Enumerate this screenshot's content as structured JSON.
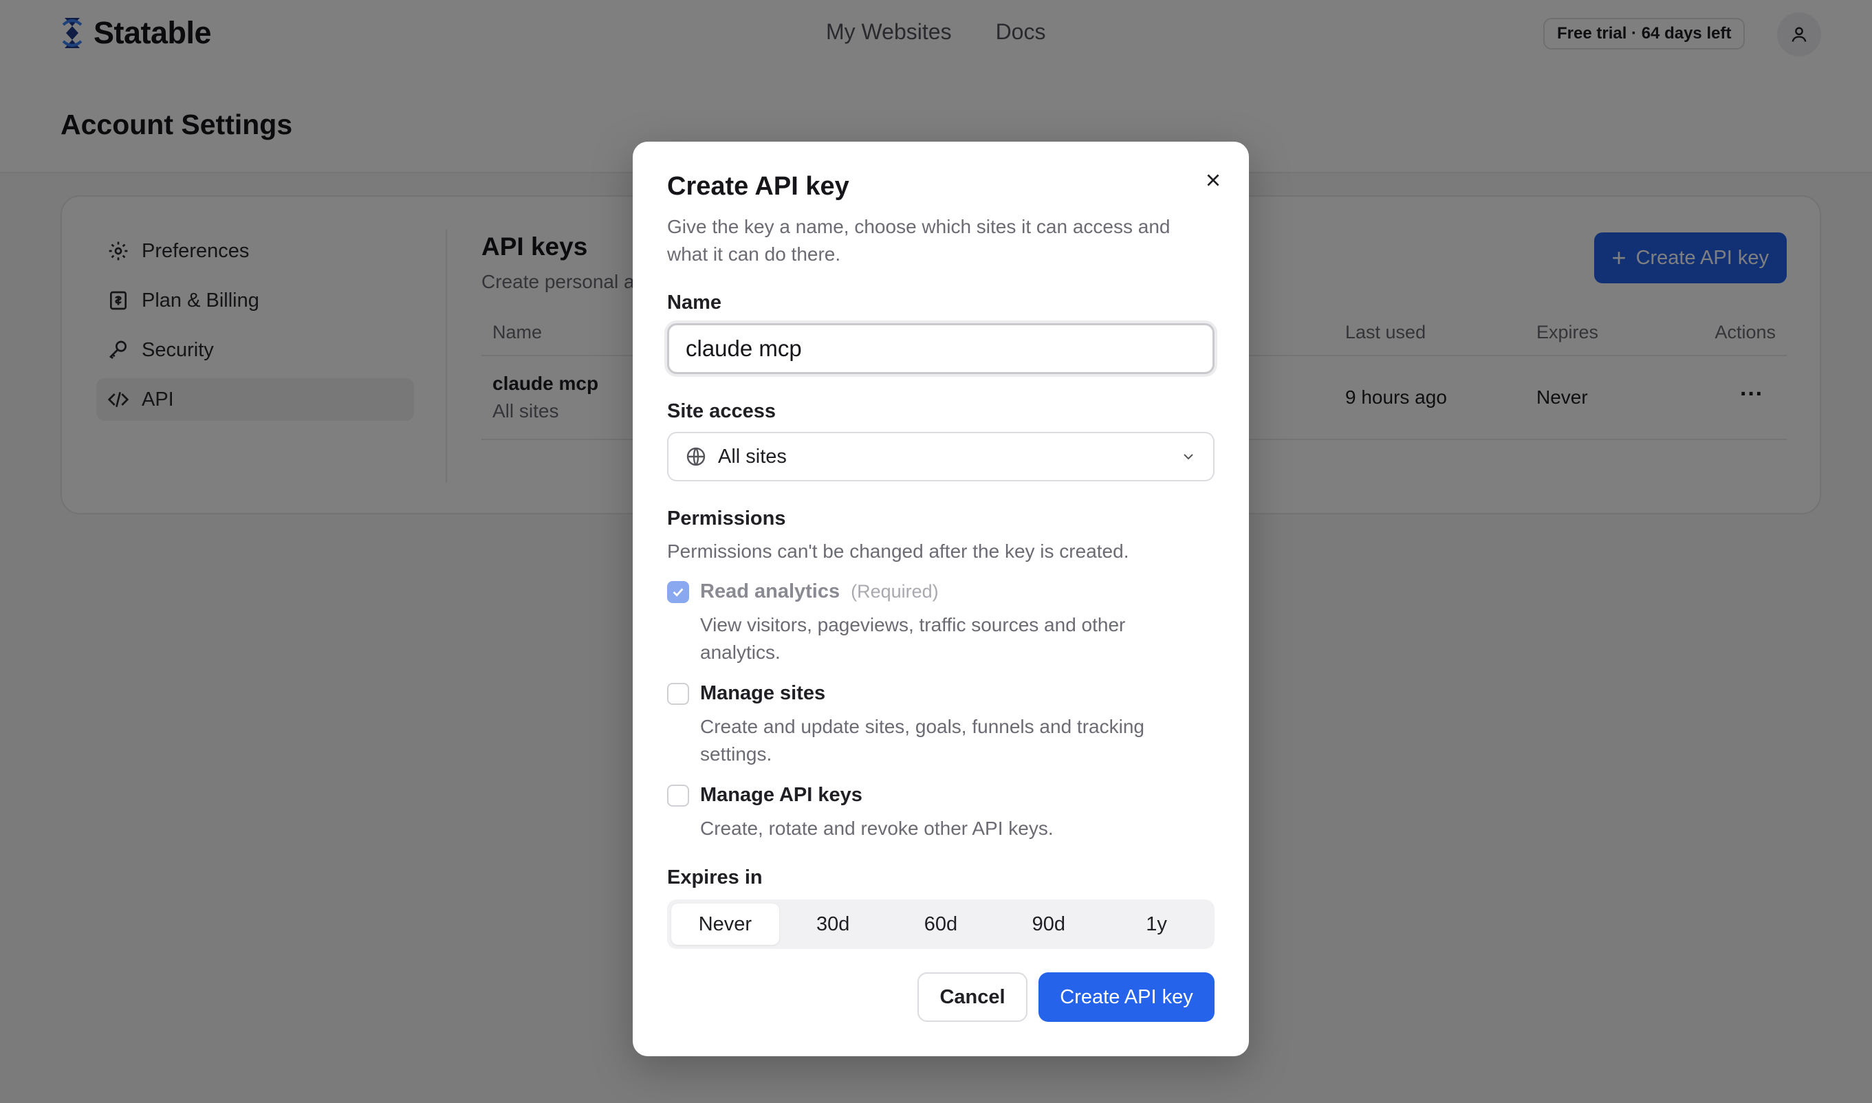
{
  "header": {
    "brand": "Statable",
    "nav": [
      "My Websites",
      "Docs"
    ],
    "trial_badge": "Free trial · 64 days left"
  },
  "page": {
    "title": "Account Settings"
  },
  "sidebar": {
    "items": [
      {
        "label": "Preferences",
        "icon": "gear-icon"
      },
      {
        "label": "Plan & Billing",
        "icon": "receipt-icon"
      },
      {
        "label": "Security",
        "icon": "key-icon"
      },
      {
        "label": "API",
        "icon": "code-icon",
        "active": true
      }
    ]
  },
  "api_section": {
    "title": "API keys",
    "subtitle": "Create personal a",
    "create_button": "Create API key",
    "columns": [
      "Name",
      "Last used",
      "Expires",
      "Actions"
    ],
    "rows": [
      {
        "name": "claude mcp",
        "scope": "All sites",
        "last_used": "9 hours ago",
        "expires": "Never"
      }
    ]
  },
  "modal": {
    "title": "Create API key",
    "description": "Give the key a name, choose which sites it can access and what it can do there.",
    "name_label": "Name",
    "name_value": "claude mcp",
    "site_access_label": "Site access",
    "site_access_value": "All sites",
    "permissions_label": "Permissions",
    "permissions_note": "Permissions can't be changed after the key is created.",
    "permissions": [
      {
        "name": "Read analytics",
        "tag": "(Required)",
        "desc": "View visitors, pageviews, traffic sources and other analytics.",
        "checked": true
      },
      {
        "name": "Manage sites",
        "desc": "Create and update sites, goals, funnels and tracking settings.",
        "checked": false
      },
      {
        "name": "Manage API keys",
        "desc": "Create, rotate and revoke other API keys.",
        "checked": false
      }
    ],
    "expires_label": "Expires in",
    "expires_options": [
      "Never",
      "30d",
      "60d",
      "90d",
      "1y"
    ],
    "expires_selected": "Never",
    "cancel": "Cancel",
    "submit": "Create API key"
  },
  "colors": {
    "accent": "#2563eb",
    "overlay": "rgba(0,0,0,0.5)",
    "checkbox_checked": "#8aa8f0"
  }
}
